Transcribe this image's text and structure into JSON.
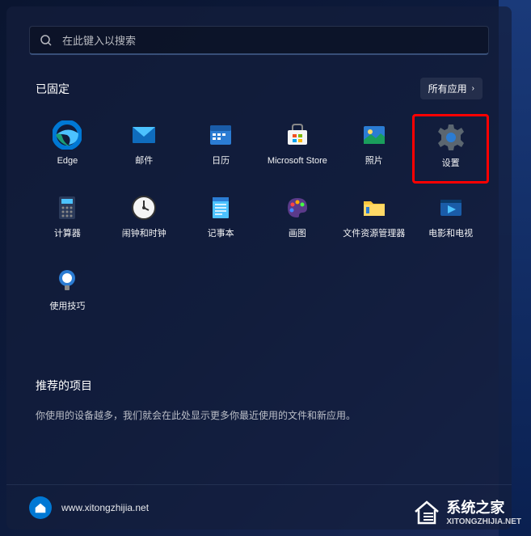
{
  "search": {
    "placeholder": "在此键入以搜索"
  },
  "pinned": {
    "title": "已固定",
    "all_apps_label": "所有应用",
    "apps": [
      {
        "label": "Edge",
        "icon": "edge"
      },
      {
        "label": "邮件",
        "icon": "mail"
      },
      {
        "label": "日历",
        "icon": "calendar"
      },
      {
        "label": "Microsoft Store",
        "icon": "store"
      },
      {
        "label": "照片",
        "icon": "photos"
      },
      {
        "label": "设置",
        "icon": "settings",
        "highlighted": true
      },
      {
        "label": "计算器",
        "icon": "calculator"
      },
      {
        "label": "闹钟和时钟",
        "icon": "clock"
      },
      {
        "label": "记事本",
        "icon": "notepad"
      },
      {
        "label": "画图",
        "icon": "paint"
      },
      {
        "label": "文件资源管理器",
        "icon": "explorer"
      },
      {
        "label": "电影和电视",
        "icon": "movies"
      },
      {
        "label": "使用技巧",
        "icon": "tips"
      }
    ]
  },
  "recommended": {
    "title": "推荐的项目",
    "empty_text": "你使用的设备越多，我们就会在此处显示更多你最近使用的文件和新应用。"
  },
  "footer": {
    "url": "www.xitongzhijia.net"
  },
  "watermark": {
    "text": "系统之家",
    "sub": "XITONGZHIJIA.NET"
  }
}
